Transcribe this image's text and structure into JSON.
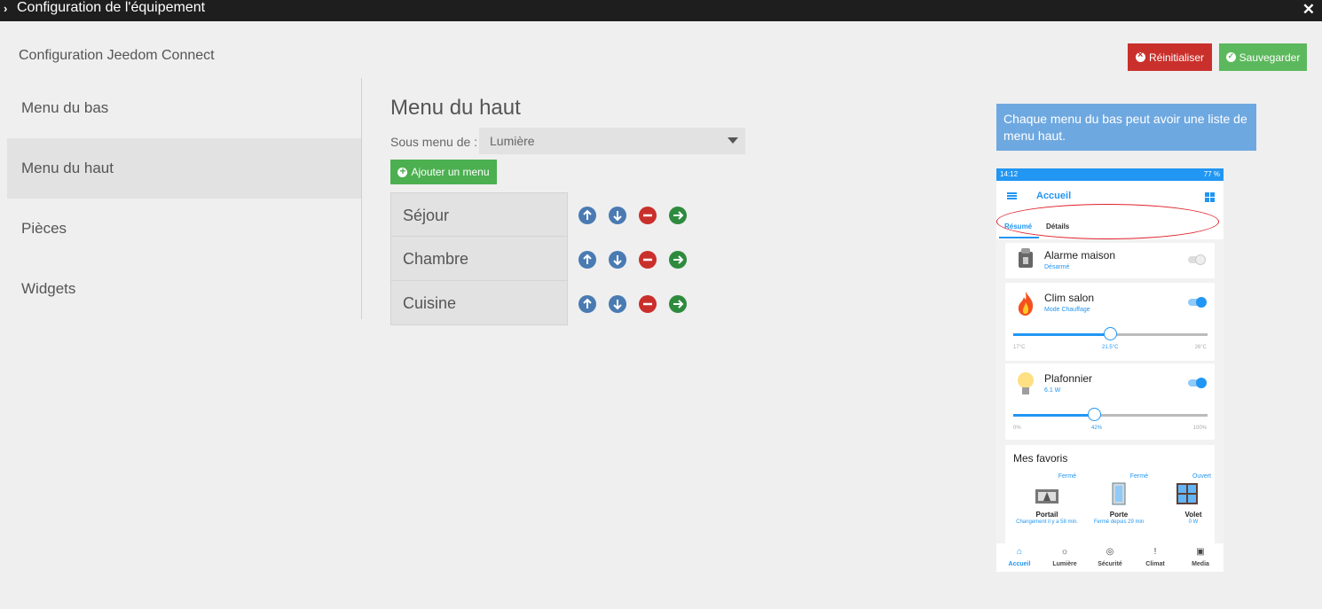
{
  "window": {
    "title": "Configuration de l'équipement"
  },
  "page": {
    "heading": "Configuration Jeedom Connect"
  },
  "toolbar": {
    "reset_label": "Réinitialiser",
    "save_label": "Sauvegarder"
  },
  "sidebar": {
    "items": [
      {
        "label": "Menu du bas",
        "active": false
      },
      {
        "label": "Menu du haut",
        "active": true
      },
      {
        "label": "Pièces",
        "active": false
      },
      {
        "label": "Widgets",
        "active": false
      }
    ]
  },
  "main": {
    "title": "Menu du haut",
    "submenu_label": "Sous menu de :",
    "submenu_value": "Lumière",
    "add_label": "Ajouter un menu",
    "menus": [
      {
        "name": "Séjour"
      },
      {
        "name": "Chambre"
      },
      {
        "name": "Cuisine"
      }
    ]
  },
  "tip": {
    "text": "Chaque menu du bas peut avoir une liste de menu haut."
  },
  "preview": {
    "status_time": "14:12",
    "status_right": "77 %",
    "app_title": "Accueil",
    "tabs": [
      "Résumé",
      "Détails"
    ],
    "cards": {
      "alarm": {
        "name": "Alarme maison",
        "sub": "Désarmé"
      },
      "clim": {
        "name": "Clim salon",
        "sub": "Mode Chauffage",
        "min": "17°C",
        "value": "21.5°C",
        "max": "26°C",
        "fraction": 0.5
      },
      "light": {
        "name": "Plafonnier",
        "sub": "6.1 W",
        "min": "0%",
        "value": "42%",
        "max": "100%",
        "fraction": 0.42
      }
    },
    "favorites": {
      "title": "Mes favoris",
      "items": [
        {
          "status": "Fermé",
          "name": "Portail",
          "sub": "Changement il y a 58 min."
        },
        {
          "status": "Fermé",
          "name": "Porte",
          "sub": "Fermé depuis 29 min"
        },
        {
          "status": "Ouvert",
          "name": "Volet",
          "sub": "0 W"
        }
      ]
    },
    "nav": [
      "Accueil",
      "Lumière",
      "Sécurité",
      "Climat",
      "Media"
    ]
  },
  "colors": {
    "danger": "#c9302c",
    "success": "#5cb85c",
    "primary": "#4a7ab2",
    "accent": "#2196f3"
  }
}
